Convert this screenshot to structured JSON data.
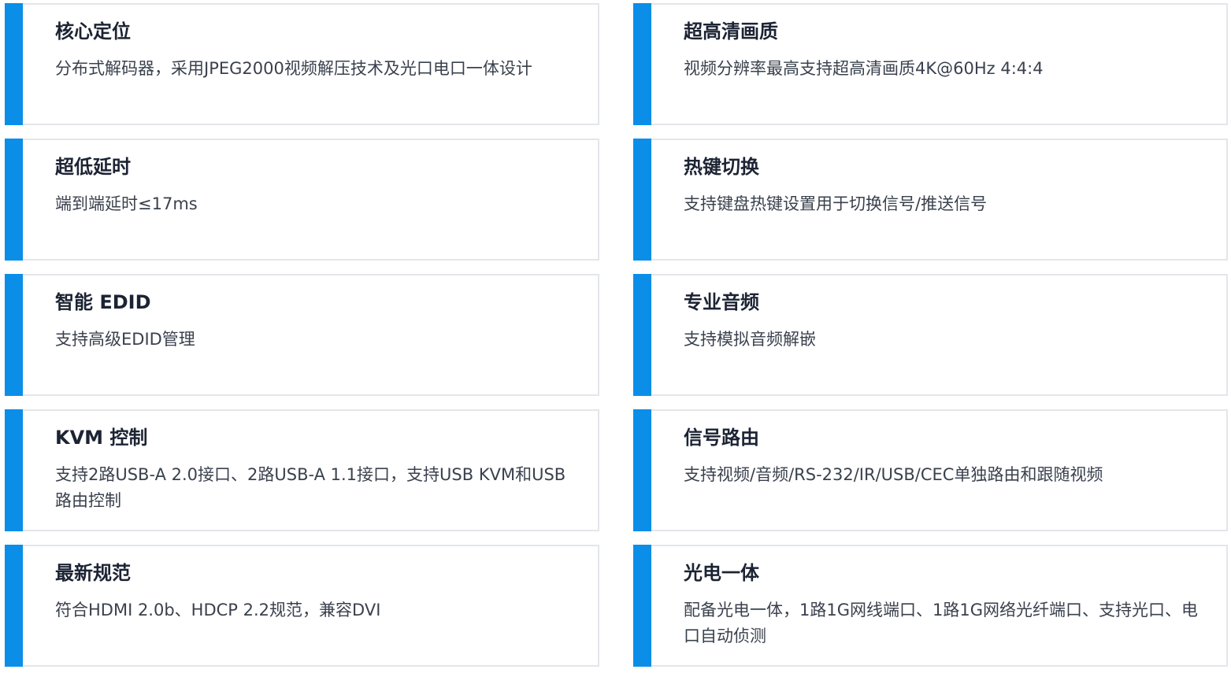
{
  "features": [
    {
      "title": "核心定位",
      "desc": "分布式解码器，采用JPEG2000视频解压技术及光口电口一体设计"
    },
    {
      "title": "超高清画质",
      "desc": "视频分辨率最高支持超高清画质4K@60Hz 4:4:4"
    },
    {
      "title": "超低延时",
      "desc": "端到端延时≤17ms"
    },
    {
      "title": "热键切换",
      "desc": "支持键盘热键设置用于切换信号/推送信号"
    },
    {
      "title": "智能 EDID",
      "desc": "支持高级EDID管理"
    },
    {
      "title": "专业音频",
      "desc": "支持模拟音频解嵌"
    },
    {
      "title": "KVM 控制",
      "desc": "支持2路USB-A 2.0接口、2路USB-A 1.1接口，支持USB KVM和USB路由控制"
    },
    {
      "title": "信号路由",
      "desc": "支持视频/音频/RS-232/IR/USB/CEC单独路由和跟随视频"
    },
    {
      "title": "最新规范",
      "desc": "符合HDMI 2.0b、HDCP 2.2规范，兼容DVI"
    },
    {
      "title": "光电一体",
      "desc": "配备光电一体，1路1G网线端口、1路1G网络光纤端口、支持光口、电口自动侦测"
    }
  ],
  "colors": {
    "accent": "#0a8ee8",
    "border": "#e3e6ea",
    "title": "#1c2333",
    "text": "#3a414d"
  }
}
